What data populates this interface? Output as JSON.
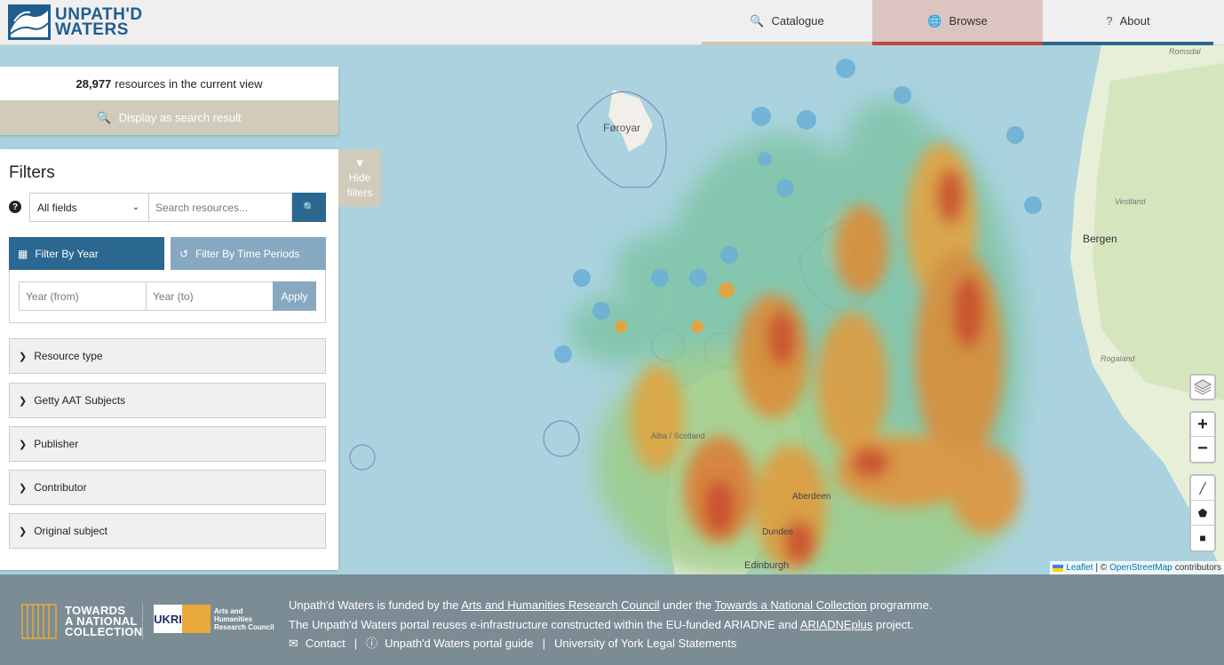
{
  "header": {
    "logo_line1": "UNPATH'D",
    "logo_line2": "WATERS",
    "nav": {
      "catalogue": "Catalogue",
      "browse": "Browse",
      "about": "About"
    }
  },
  "results": {
    "count": "28,977",
    "count_suffix": "resources in the current view",
    "display_label": "Display as search result"
  },
  "filters": {
    "title": "Filters",
    "field_select": "All fields",
    "search_placeholder": "Search resources...",
    "tab_year": "Filter By Year",
    "tab_periods": "Filter By Time Periods",
    "year_from_placeholder": "Year (from)",
    "year_to_placeholder": "Year (to)",
    "apply": "Apply",
    "accordion": [
      "Resource type",
      "Getty AAT Subjects",
      "Publisher",
      "Contributor",
      "Original subject"
    ],
    "hide_line1": "Hide",
    "hide_line2": "filters"
  },
  "map": {
    "labels": {
      "faroe": "Føroyar",
      "bergen": "Bergen",
      "vestland": "Vestland",
      "rogaland": "Rogaland",
      "romsdal": "Romsdal",
      "scotland": "Alba / Scotland",
      "aberdeen": "Aberdeen",
      "dundee": "Dundee",
      "edinburgh": "Edinburgh"
    },
    "attribution": {
      "leaflet": "Leaflet",
      "sep": "| ©",
      "osm": "OpenStreetMap",
      "suffix": "contributors"
    }
  },
  "footer": {
    "tanc": [
      "TOWARDS",
      "A NATIONAL",
      "COLLECTION"
    ],
    "ukri": "UKRI",
    "ahrc": [
      "Arts and",
      "Humanities",
      "Research Council"
    ],
    "line1_pre": "Unpath'd Waters is funded by the",
    "line1_link1": "Arts and Humanities Research Council",
    "line1_mid": "under the",
    "line1_link2": "Towards a National Collection",
    "line1_post": "programme.",
    "line2_pre": "The Unpath'd Waters portal reuses e-infrastructure constructed within the EU-funded ARIADNE and",
    "line2_link": "ARIADNEplus",
    "line2_post": "project.",
    "contact": "Contact",
    "guide": "Unpath'd Waters portal guide",
    "legal": "University of York Legal Statements",
    "separator": "|"
  }
}
